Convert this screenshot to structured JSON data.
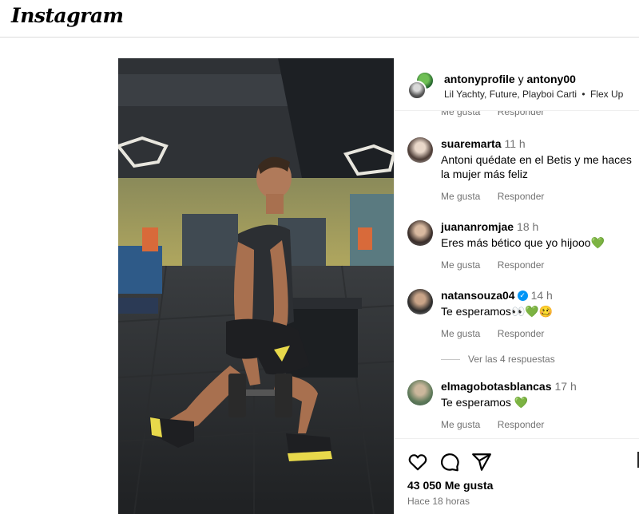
{
  "app": {
    "logo": "Instagram"
  },
  "post": {
    "users": {
      "first": "antonyprofile",
      "joiner": "y",
      "second": "antony00"
    },
    "audio": {
      "artists": "Lil Yachty, Future, Playboi Carti",
      "separator": "•",
      "track": "Flex Up"
    }
  },
  "cut_actions": {
    "like": "Me gusta",
    "reply": "Responder"
  },
  "comments": [
    {
      "user": "suaremarta",
      "time": "11 h",
      "text": "Antoni quédate en el Betis y me haces la mujer más feliz",
      "like": "Me gusta",
      "reply": "Responder"
    },
    {
      "user": "juananromjae",
      "time": "18 h",
      "text": "Eres más bético que yo hijooo",
      "emoji": "💚",
      "like": "Me gusta",
      "reply": "Responder"
    },
    {
      "user": "natansouza04",
      "time": "14 h",
      "verified": true,
      "text": "Te esperamos",
      "emoji": "👀💚🥴",
      "like": "Me gusta",
      "reply": "Responder"
    },
    {
      "user": "elmagobotasblancas",
      "time": "17 h",
      "text": "Te esperamos",
      "emoji": "💚",
      "like": "Me gusta",
      "reply": "Responder"
    }
  ],
  "view_replies": "Ver las 4 respuestas",
  "footer": {
    "likes": "43 050 Me gusta",
    "time_ago": "Hace 18 horas"
  },
  "icons": [
    "heart-icon",
    "comment-icon",
    "share-icon",
    "verified-badge-icon"
  ],
  "colors": {
    "accent_green": "#2dbb3a",
    "verified_blue": "#0095f6",
    "muted_text": "#737373"
  }
}
